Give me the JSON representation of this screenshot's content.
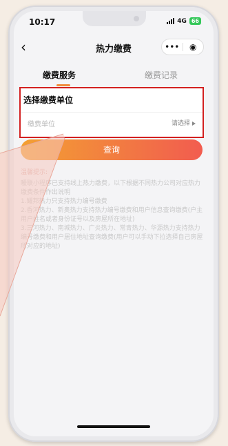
{
  "status_bar": {
    "time": "10:17",
    "network": "4G",
    "battery": "66"
  },
  "nav": {
    "back_icon": "chevron-left-icon",
    "title": "热力缴费",
    "more_icon": "•••",
    "close_icon": "◉"
  },
  "tabs": [
    {
      "label": "缴费服务",
      "active": true
    },
    {
      "label": "缴费记录",
      "active": false
    }
  ],
  "unit_section": {
    "title": "选择缴费单位",
    "field_label": "缴费单位",
    "select_text": "请选择"
  },
  "query_button": {
    "label": "查询"
  },
  "tips": {
    "title": "温馨提示:",
    "lines": [
      "暖联小程序已支持线上热力缴费，以下根据不同热力公司对应热力缴费条件作出说明",
      "1.耀邦热力只支持热力编号缴费",
      "2.香河热力、新奥热力支持热力编号缴费和用户信息查询缴费(户主用户姓名或者身份证号以及房屋所在地址)",
      "3.三河热力、南城热力、广炎热力、常青热力、华源热力支持热力编号缴费和用户居住地址查询缴费(用户可以手动下拉选择自己房屋所对应的地址)"
    ]
  },
  "colors": {
    "accent": "#f08b3a",
    "highlight_border": "#d32020",
    "button_start": "#f3a032",
    "button_end": "#f25c4f"
  }
}
